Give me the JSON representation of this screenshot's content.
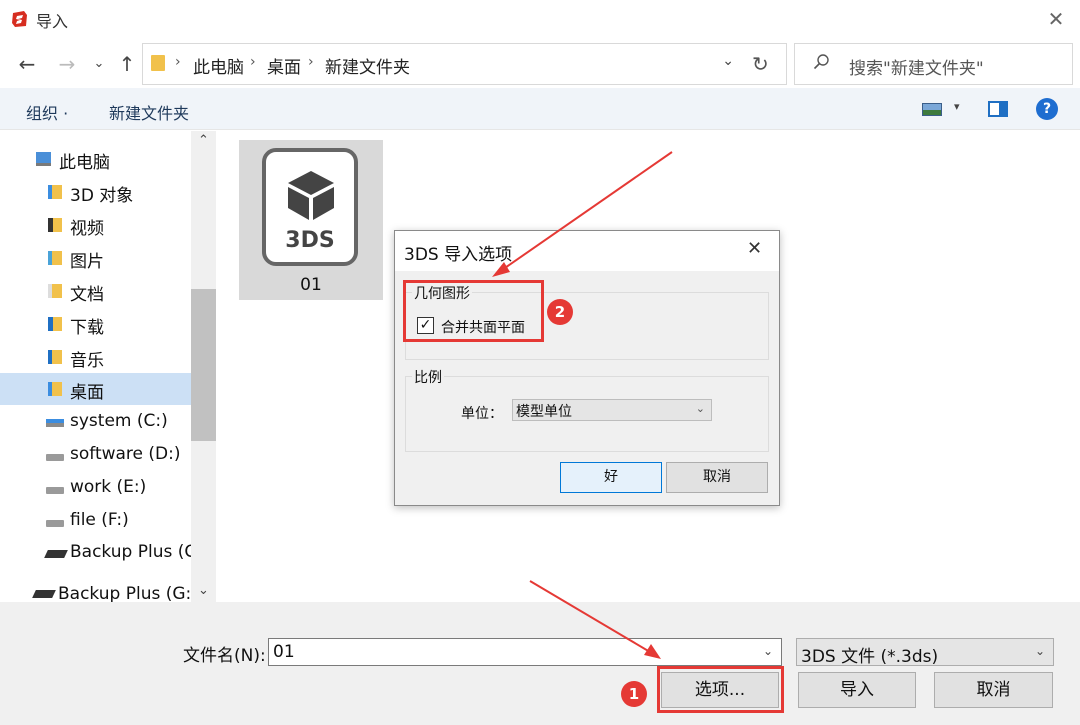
{
  "window": {
    "title": "导入"
  },
  "address": {
    "crumbs": [
      "此电脑",
      "桌面",
      "新建文件夹"
    ],
    "search_placeholder": "搜索\"新建文件夹\""
  },
  "toolbar": {
    "organize": "组织 ·",
    "new_folder": "新建文件夹",
    "help": "?"
  },
  "nav": {
    "items": [
      {
        "label": "此电脑",
        "icon": "computer-icon"
      },
      {
        "label": "3D 对象",
        "icon": "3d-objects-icon"
      },
      {
        "label": "视频",
        "icon": "video-folder-icon"
      },
      {
        "label": "图片",
        "icon": "pictures-folder-icon"
      },
      {
        "label": "文档",
        "icon": "documents-folder-icon"
      },
      {
        "label": "下载",
        "icon": "downloads-folder-icon"
      },
      {
        "label": "音乐",
        "icon": "music-folder-icon"
      },
      {
        "label": "桌面",
        "icon": "desktop-folder-icon",
        "selected": true
      },
      {
        "label": "system (C:)",
        "icon": "system-drive-icon"
      },
      {
        "label": "software (D:)",
        "icon": "drive-icon"
      },
      {
        "label": "work (E:)",
        "icon": "drive-icon"
      },
      {
        "label": "file (F:)",
        "icon": "drive-icon"
      },
      {
        "label": "Backup Plus (G:)",
        "icon": "external-drive-icon"
      },
      {
        "label": "Backup Plus (G:)",
        "icon": "external-drive-icon"
      }
    ]
  },
  "files": [
    {
      "name": "01",
      "type_label": "3DS"
    }
  ],
  "bottom": {
    "filename_label": "文件名(N):",
    "filename_value": "01",
    "filetype_value": "3DS 文件 (*.3ds)",
    "options_button": "选项...",
    "import_button": "导入",
    "cancel_button": "取消"
  },
  "dialog": {
    "title": "3DS 导入选项",
    "geometry_group": "几何图形",
    "merge_coplanar_label": "合并共面平面",
    "merge_coplanar_checked": true,
    "scale_group": "比例",
    "unit_label": "单位：",
    "unit_value": "模型单位",
    "ok_button": "好",
    "cancel_button": "取消"
  },
  "annotations": {
    "badge_1": "1",
    "badge_2": "2"
  },
  "colors": {
    "accent": "#0078d7",
    "selection": "#cce0f5",
    "annotation_red": "#e53935"
  }
}
